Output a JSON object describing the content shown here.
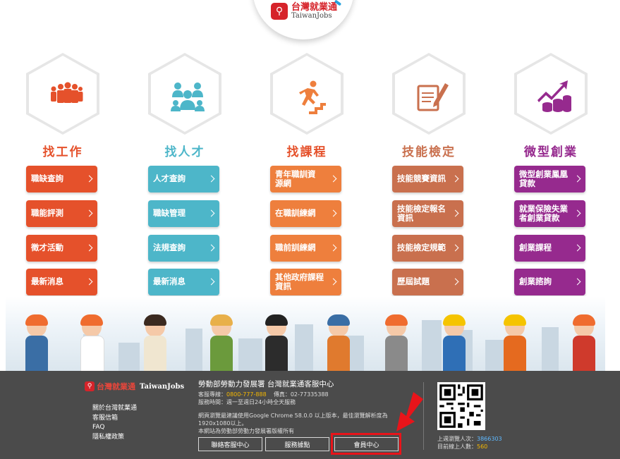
{
  "brand": {
    "name_zh": "台灣就業通",
    "name_en": "TaiwanJobs"
  },
  "columns": [
    {
      "title": "找工作",
      "color": "#e5512b",
      "icon": "people-group-icon",
      "buttons": [
        "職缺查詢",
        "職能評測",
        "徵才活動",
        "最新消息"
      ]
    },
    {
      "title": "找人才",
      "color": "#4db6c9",
      "icon": "talent-team-icon",
      "buttons": [
        "人才查詢",
        "職缺管理",
        "法規查詢",
        "最新消息"
      ]
    },
    {
      "title": "找課程",
      "color": "#ee7f3d",
      "icon": "running-up-stairs-icon",
      "buttons": [
        "青年職訓資源網",
        "在職訓練網",
        "職前訓練網",
        "其他政府課程資訊"
      ]
    },
    {
      "title": "技能檢定",
      "color": "#c9704e",
      "icon": "certificate-pen-icon",
      "buttons": [
        "技能競賽資訊",
        "技能檢定報名資訊",
        "技能檢定規範",
        "歷屆試題"
      ]
    },
    {
      "title": "微型創業",
      "color": "#962a8e",
      "icon": "growth-coins-icon",
      "buttons": [
        "微型創業鳳凰貸款",
        "就業保險失業者創業貸款",
        "創業課程",
        "創業諮詢"
      ]
    }
  ],
  "footer": {
    "links": [
      "關於台灣就業通",
      "客服信箱",
      "FAQ",
      "隱私權政策"
    ],
    "org": "勞動部勞動力發展署 台灣就業通客服中心",
    "hotline_label": "客服專線：",
    "hotline": "0800-777-888",
    "fax_label": "傳真：",
    "fax": "02-77335388",
    "hours": "服務時間：週一至週日24小時全天服務",
    "note1": "網頁瀏覽最建議使用Google Chrome 58.0.0 以上版本，最佳瀏覽解析度為1920x1080以上。",
    "note2": "本網站為勞動部勞動力發展署版權所有",
    "buttons": [
      "聯絡客服中心",
      "服務據點",
      "會員中心"
    ],
    "stats_last_week_label": "上週瀏覽人次：",
    "stats_last_week": "3866303",
    "stats_online_label": "目前線上人數：",
    "stats_online": "560"
  },
  "colors": {
    "footer_bg": "#4b4b4b",
    "highlight": "#e8141a"
  }
}
